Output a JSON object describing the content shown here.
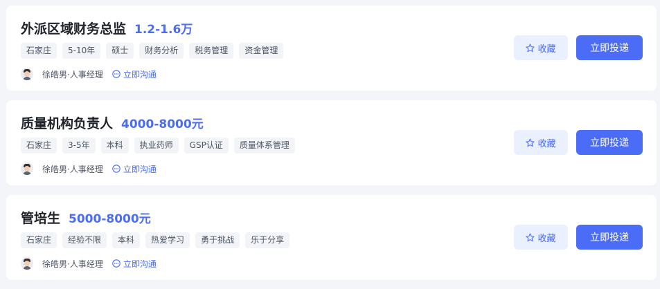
{
  "jobs": [
    {
      "title": "外派区域财务总监",
      "salary": "1.2-1.6万",
      "tags": [
        "石家庄",
        "5-10年",
        "硕士",
        "财务分析",
        "税务管理",
        "资金管理"
      ],
      "recruiter": "徐皓男·人事经理",
      "chat_label": "立即沟通",
      "favorite_label": "收藏",
      "apply_label": "立即投递"
    },
    {
      "title": "质量机构负责人",
      "salary": "4000-8000元",
      "tags": [
        "石家庄",
        "3-5年",
        "本科",
        "执业药师",
        "GSP认证",
        "质量体系管理"
      ],
      "recruiter": "徐皓男·人事经理",
      "chat_label": "立即沟通",
      "favorite_label": "收藏",
      "apply_label": "立即投递"
    },
    {
      "title": "管培生",
      "salary": "5000-8000元",
      "tags": [
        "石家庄",
        "经验不限",
        "本科",
        "热爱学习",
        "勇于挑战",
        "乐于分享"
      ],
      "recruiter": "徐皓男·人事经理",
      "chat_label": "立即沟通",
      "favorite_label": "收藏",
      "apply_label": "立即投递"
    }
  ],
  "icons": {
    "favorite": "star-icon",
    "chat": "chat-bubble-icon",
    "avatar": "recruiter-avatar"
  },
  "colors": {
    "accent": "#4a6cf7",
    "favorite_bg": "#eaf0fe",
    "tag_bg": "#f2f4f7",
    "page_bg": "#f4f5f9"
  }
}
